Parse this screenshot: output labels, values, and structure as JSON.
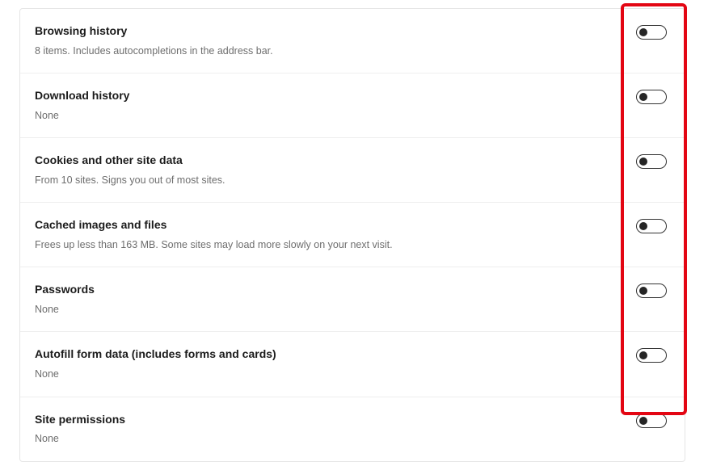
{
  "items": [
    {
      "title": "Browsing history",
      "subtitle": "8 items. Includes autocompletions in the address bar.",
      "name": "browsing-history"
    },
    {
      "title": "Download history",
      "subtitle": "None",
      "name": "download-history"
    },
    {
      "title": "Cookies and other site data",
      "subtitle": "From 10 sites. Signs you out of most sites.",
      "name": "cookies-site-data"
    },
    {
      "title": "Cached images and files",
      "subtitle": "Frees up less than 163 MB. Some sites may load more slowly on your next visit.",
      "name": "cached-images-files"
    },
    {
      "title": "Passwords",
      "subtitle": "None",
      "name": "passwords"
    },
    {
      "title": "Autofill form data (includes forms and cards)",
      "subtitle": "None",
      "name": "autofill-form-data"
    },
    {
      "title": "Site permissions",
      "subtitle": "None",
      "name": "site-permissions"
    }
  ]
}
